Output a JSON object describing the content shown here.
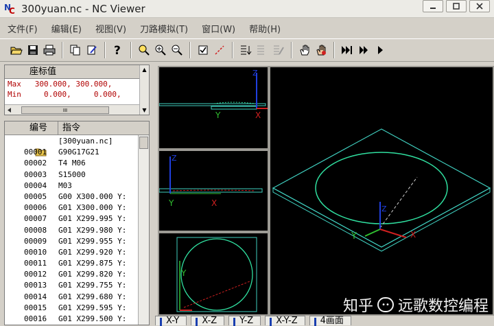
{
  "window": {
    "title": "300yuan.nc - NC Viewer"
  },
  "menu": [
    "文件(F)",
    "编辑(E)",
    "视图(V)",
    "刀路模拟(T)",
    "窗口(W)",
    "帮助(H)"
  ],
  "coords": {
    "header": "座标值",
    "rows": [
      {
        "label": "Max",
        "x": "300.000,",
        "y": "300.000,"
      },
      {
        "label": "Min",
        "x": "0.000,",
        "y": "0.000,"
      }
    ],
    "scroll_grip": "III"
  },
  "code": {
    "col_num": "编号",
    "col_cmd": "指令",
    "file": "[300yuan.nc]",
    "rows": [
      {
        "num": "00001",
        "cmd": "G90G17G21"
      },
      {
        "num": "00002",
        "cmd": "T4 M06"
      },
      {
        "num": "00003",
        "cmd": "S15000"
      },
      {
        "num": "00004",
        "cmd": "M03"
      },
      {
        "num": "00005",
        "cmd": "G00 X300.000 Y:"
      },
      {
        "num": "00006",
        "cmd": "G01 X300.000 Y:"
      },
      {
        "num": "00007",
        "cmd": "G01 X299.995 Y:"
      },
      {
        "num": "00008",
        "cmd": "G01 X299.980 Y:"
      },
      {
        "num": "00009",
        "cmd": "G01 X299.955 Y:"
      },
      {
        "num": "00010",
        "cmd": "G01 X299.920 Y:"
      },
      {
        "num": "00011",
        "cmd": "G01 X299.875 Y:"
      },
      {
        "num": "00012",
        "cmd": "G01 X299.820 Y:"
      },
      {
        "num": "00013",
        "cmd": "G01 X299.755 Y:"
      },
      {
        "num": "00014",
        "cmd": "G01 X299.680 Y:"
      },
      {
        "num": "00015",
        "cmd": "G01 X299.595 Y:"
      },
      {
        "num": "00016",
        "cmd": "G01 X299.500 Y:"
      }
    ]
  },
  "axes": {
    "x": "X",
    "y": "Y",
    "z": "Z"
  },
  "tabs": [
    "X-Y",
    "X-Z",
    "Y-Z",
    "X-Y-Z",
    "4画面"
  ],
  "watermark": {
    "left": "知乎",
    "right": "远歌数控编程"
  },
  "colors": {
    "axis_x": "#d02020",
    "axis_y": "#30c030",
    "axis_z": "#2040e0",
    "part_outline": "#40d0c0",
    "toolpath": "#30e0a0"
  }
}
